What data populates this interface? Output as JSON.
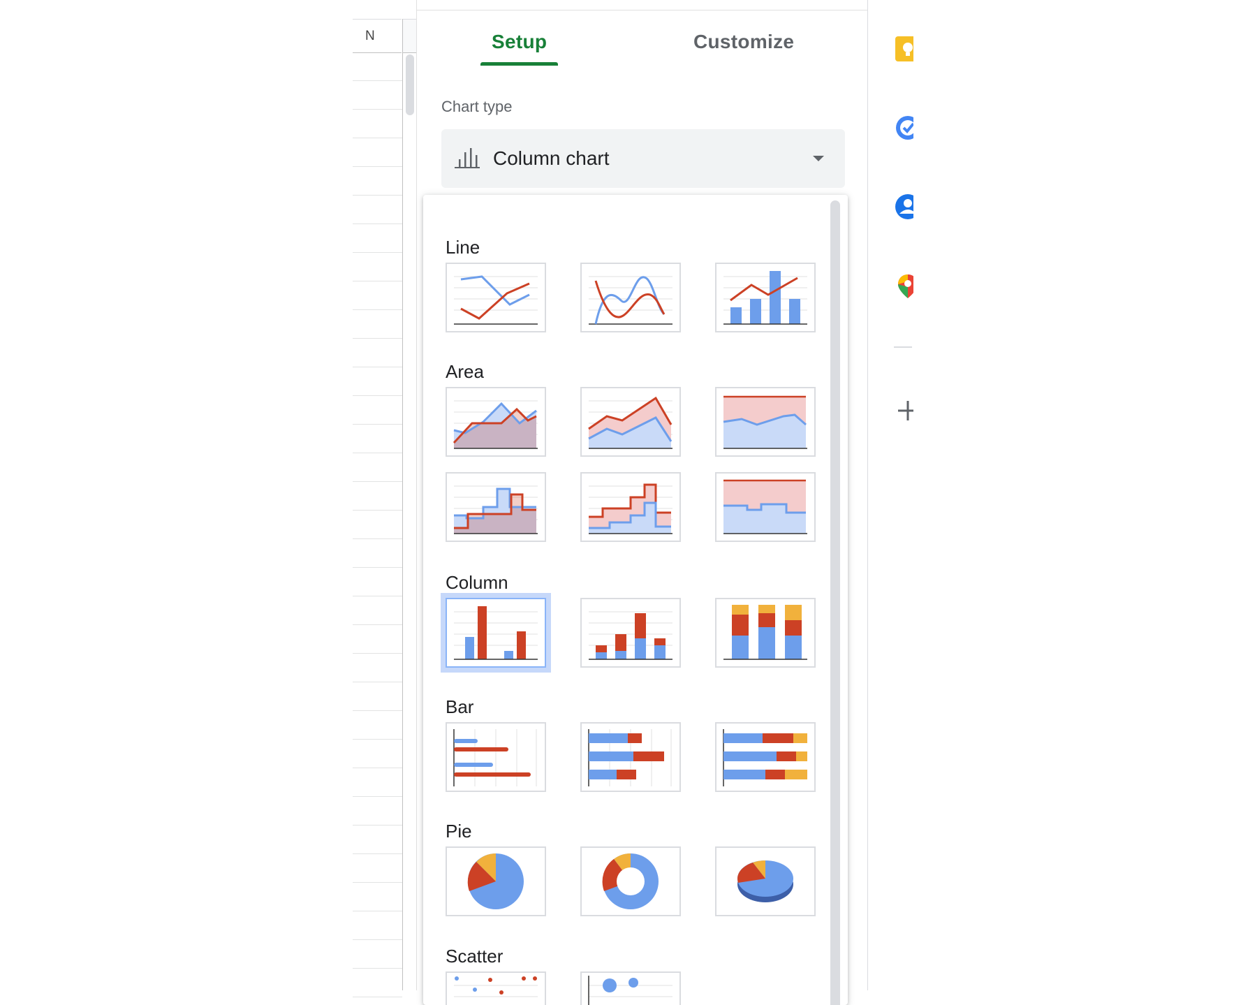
{
  "sheet": {
    "column_header": "N"
  },
  "panel": {
    "tabs": [
      {
        "label": "Setup",
        "active": true
      },
      {
        "label": "Customize",
        "active": false
      }
    ],
    "chart_type_label": "Chart type",
    "chart_type_value": "Column chart",
    "chart_type_icon": "column-chart-icon",
    "dropdown_icon": "arrow-drop-down-icon"
  },
  "menu": {
    "categories": [
      {
        "label": "Line",
        "options": [
          "line-chart",
          "smooth-line-chart",
          "combo-chart"
        ]
      },
      {
        "label": "Area",
        "options": [
          "area-chart",
          "stacked-area-chart",
          "100-percent-stacked-area-chart",
          "stepped-area-chart",
          "stacked-stepped-area-chart",
          "100-percent-stacked-stepped-area-chart"
        ]
      },
      {
        "label": "Column",
        "options": [
          "column-chart",
          "stacked-column-chart",
          "100-percent-stacked-column-chart"
        ],
        "selected": "column-chart"
      },
      {
        "label": "Bar",
        "options": [
          "bar-chart",
          "stacked-bar-chart",
          "100-percent-stacked-bar-chart"
        ]
      },
      {
        "label": "Pie",
        "options": [
          "pie-chart",
          "doughnut-chart",
          "3d-pie-chart"
        ]
      },
      {
        "label": "Scatter",
        "options": [
          "scatter-chart",
          "bubble-chart"
        ]
      }
    ]
  },
  "rail": {
    "icons": [
      "keep-icon",
      "tasks-icon",
      "contacts-icon",
      "maps-icon",
      "add-icon"
    ]
  },
  "colors": {
    "blue": "#6d9eeb",
    "red": "#cc4125",
    "yellow": "#f1b13c",
    "green_accent": "#188038",
    "selected_highlight": "#c6d8fa"
  }
}
